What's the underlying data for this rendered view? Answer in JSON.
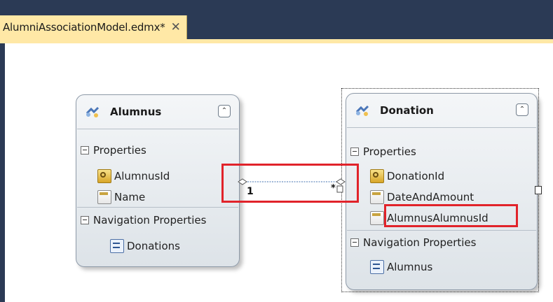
{
  "document_tab": {
    "title": "AlumniAssociationModel.edmx*",
    "close_glyph": "✕"
  },
  "entities": [
    {
      "name": "Alumnus",
      "icon": "entity-icon",
      "sections": [
        {
          "label": "Properties",
          "items": [
            {
              "label": "AlumnusId",
              "icon": "key-property-icon"
            },
            {
              "label": "Name",
              "icon": "property-icon"
            }
          ]
        },
        {
          "label": "Navigation Properties",
          "items": [
            {
              "label": "Donations",
              "icon": "navigation-property-icon"
            }
          ]
        }
      ]
    },
    {
      "name": "Donation",
      "icon": "entity-icon",
      "sections": [
        {
          "label": "Properties",
          "items": [
            {
              "label": "DonationId",
              "icon": "key-property-icon"
            },
            {
              "label": "DateAndAmount",
              "icon": "property-icon"
            },
            {
              "label": "AlumnusAlumnusId",
              "icon": "property-icon"
            }
          ]
        },
        {
          "label": "Navigation Properties",
          "items": [
            {
              "label": "Alumnus",
              "icon": "navigation-property-icon"
            }
          ]
        }
      ]
    }
  ],
  "association": {
    "end1_multiplicity": "1",
    "end2_multiplicity": "*"
  },
  "colors": {
    "highlight": "#e1232a",
    "tab": "#ffe8a6",
    "chrome": "#2b3a55"
  }
}
